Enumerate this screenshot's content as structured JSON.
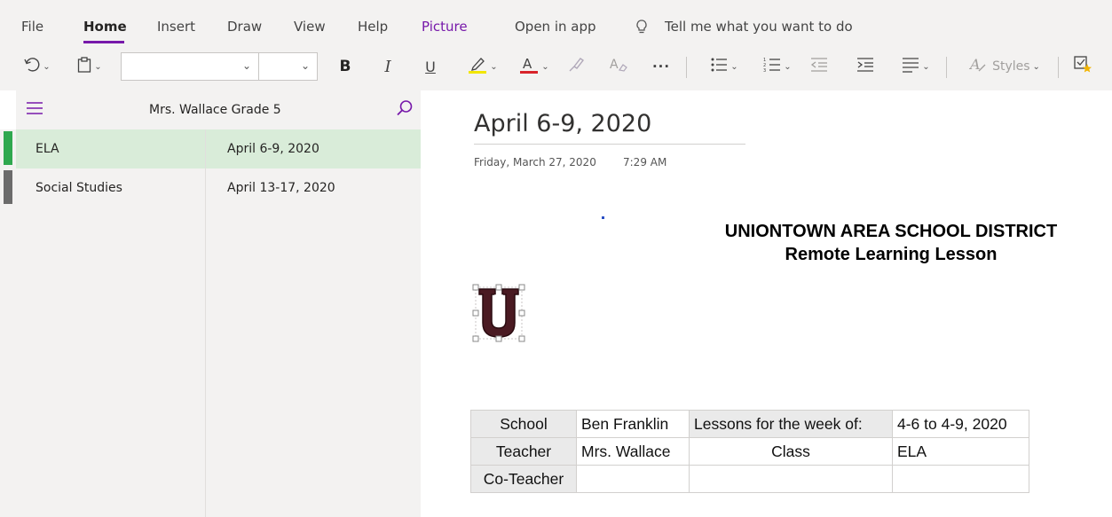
{
  "menu": {
    "tabs": [
      "File",
      "Home",
      "Insert",
      "Draw",
      "View",
      "Help",
      "Picture",
      "Open in app"
    ],
    "active_tab": "Home",
    "tell_me": "Tell me what you want to do"
  },
  "toolbar": {
    "font_value": "",
    "size_value": "",
    "bold_label": "B",
    "italic_label": "I",
    "underline_label": "U",
    "more_label": "···",
    "styles_label": "Styles",
    "highlight_color": "#f2e600",
    "font_color": "#d8232a"
  },
  "navigation": {
    "notebook_title": "Mrs. Wallace Grade 5",
    "sections": [
      {
        "label": "ELA",
        "selected": true,
        "color": "#2fa84f"
      },
      {
        "label": "Social Studies",
        "selected": false,
        "color": "#6b6b6b"
      }
    ],
    "pages": [
      {
        "label": "April 6-9, 2020",
        "selected": true
      },
      {
        "label": "April 13-17, 2020",
        "selected": false
      }
    ]
  },
  "page": {
    "title": "April 6-9, 2020",
    "date": "Friday, March 27, 2020",
    "time": "7:29 AM",
    "heading_line1": "UNIONTOWN AREA SCHOOL DISTRICT",
    "heading_line2": "Remote Learning Lesson",
    "logo_letter": "U",
    "logo_color": "#4a1a22",
    "table": [
      [
        "School",
        "Ben Franklin",
        "Lessons for the week of:",
        "4-6 to 4-9, 2020"
      ],
      [
        "Teacher",
        "Mrs. Wallace",
        "Class",
        "ELA"
      ],
      [
        "Co-Teacher",
        "",
        "",
        ""
      ]
    ]
  },
  "colors": {
    "accent": "#7719aa",
    "selected_row": "#d9ecd9",
    "pane_bg": "#f3f2f1"
  }
}
